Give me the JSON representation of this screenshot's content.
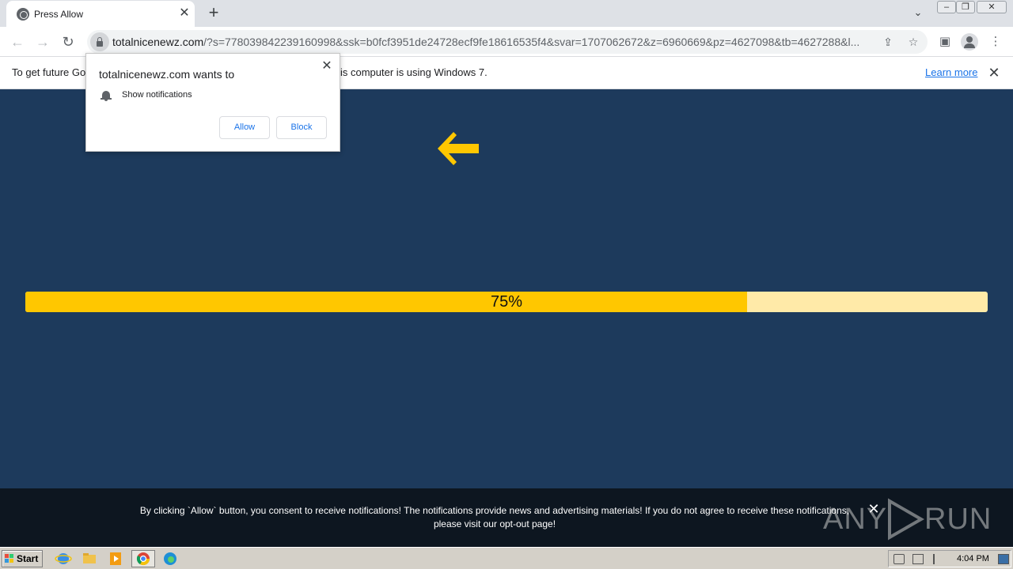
{
  "browser": {
    "tab_title": "Press Allow",
    "new_tab_label": "+",
    "url_host": "totalnicenewz.com",
    "url_rest": "/?s=778039842239160998&ssk=b0fcf3951de24728ecf9fe18616535f4&svar=1707062672&z=6960669&pz=4627098&tb=4627288&l..."
  },
  "infobar": {
    "text_before": "To get future Go",
    "text_after": "is computer is using Windows 7.",
    "learn_more": "Learn more"
  },
  "permission_popup": {
    "title": "totalnicenewz.com wants to",
    "permission": "Show notifications",
    "allow_label": "Allow",
    "block_label": "Block"
  },
  "page": {
    "progress_text": "75%",
    "progress_fraction": 0.75,
    "accent_color": "#ffc700",
    "background_color": "#1d3a5c"
  },
  "consent_banner": {
    "text": "By clicking `Allow` button, you consent to receive notifications! The notifications provide news and advertising materials! If you do not agree to receive these notifications,",
    "text_line2_prefix": "please visit our ",
    "opt_out_link": "opt-out page",
    "text_line2_suffix": "!"
  },
  "watermark": {
    "any": "ANY",
    "run": "RUN"
  },
  "taskbar": {
    "start_label": "Start",
    "clock": "4:04 PM"
  },
  "icons": [
    "globe-icon",
    "close-icon",
    "plus-icon",
    "back-icon",
    "forward-icon",
    "reload-icon",
    "lock-icon",
    "share-icon",
    "star-icon",
    "sidepanel-icon",
    "profile-icon",
    "more-icon",
    "bell-icon",
    "arrow-left-icon",
    "play-logo-icon"
  ]
}
